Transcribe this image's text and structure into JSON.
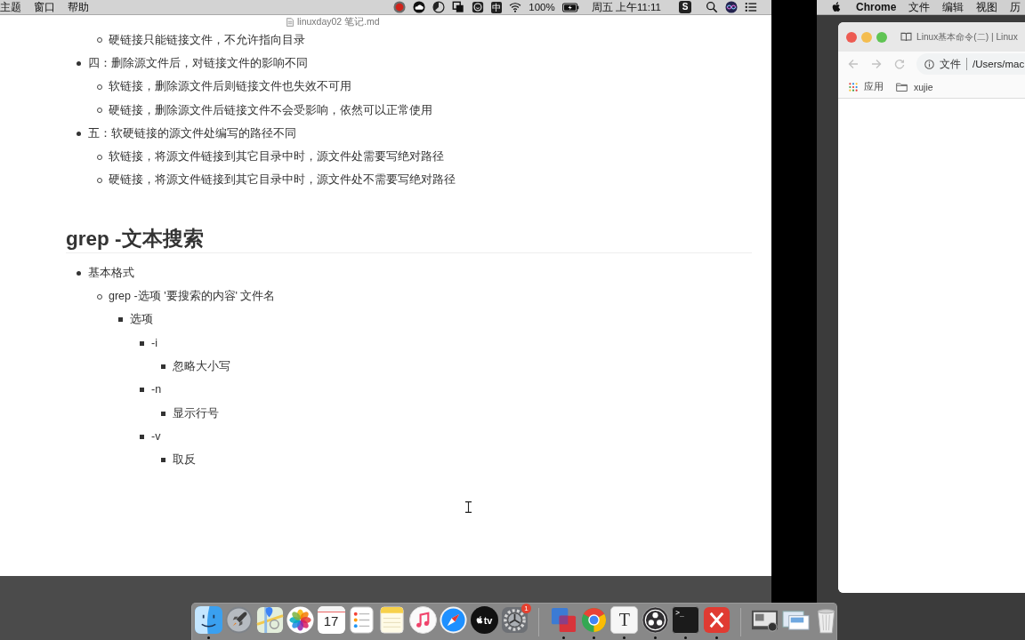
{
  "left_menu_bar": {
    "items": [
      "主题",
      "窗口",
      "帮助"
    ],
    "status_items": [
      {
        "kind": "record"
      },
      {
        "kind": "cloud"
      },
      {
        "kind": "half_circle"
      },
      {
        "kind": "squares"
      },
      {
        "kind": "smiley"
      },
      {
        "kind": "input_method",
        "label": "中"
      },
      {
        "kind": "wifi"
      },
      {
        "kind": "percent",
        "label": "100%"
      },
      {
        "kind": "battery"
      },
      {
        "kind": "clock",
        "label": "周五 上午11:11"
      },
      {
        "kind": "app",
        "label": "S"
      },
      {
        "kind": "search"
      },
      {
        "kind": "orb"
      },
      {
        "kind": "menu_list"
      }
    ]
  },
  "editor": {
    "title": "linuxday02 笔记.md",
    "sections": [
      {
        "items": [
          {
            "children": [
              {
                "text": "硬链接只能链接文件，不允许指向目录"
              }
            ]
          },
          {
            "text": "四：删除源文件后，对链接文件的影响不同",
            "children": [
              {
                "text": "软链接，删除源文件后则链接文件也失效不可用"
              },
              {
                "text": "硬链接，删除源文件后链接文件不会受影响，依然可以正常使用"
              }
            ]
          },
          {
            "text": "五：软硬链接的源文件处编写的路径不同",
            "children": [
              {
                "text": "软链接，将源文件链接到其它目录中时，源文件处需要写绝对路径"
              },
              {
                "text": "硬链接，将源文件链接到其它目录中时，源文件处不需要写绝对路径"
              }
            ]
          }
        ]
      },
      {
        "heading": "grep -文本搜索",
        "items": [
          {
            "text": "基本格式",
            "children": [
              {
                "text": "grep -选项 '要搜索的内容' 文件名",
                "children": [
                  {
                    "text": "选项",
                    "children": [
                      {
                        "text": "-i",
                        "children": [
                          {
                            "text": "忽略大小写"
                          }
                        ]
                      },
                      {
                        "text": "-n",
                        "children": [
                          {
                            "text": "显示行号"
                          }
                        ]
                      },
                      {
                        "text": "-v",
                        "children": [
                          {
                            "text": "取反"
                          }
                        ]
                      }
                    ]
                  }
                ]
              }
            ]
          }
        ]
      }
    ]
  },
  "dock": {
    "groups": [
      {
        "items": [
          {
            "kind": "finder",
            "running": true
          },
          {
            "kind": "launchpad",
            "running": false
          },
          {
            "kind": "maps",
            "running": false
          },
          {
            "kind": "photos",
            "running": false
          },
          {
            "kind": "calendar",
            "label": "17",
            "running": false
          },
          {
            "kind": "reminders",
            "running": false
          },
          {
            "kind": "notes",
            "running": false
          },
          {
            "kind": "music",
            "running": false
          },
          {
            "kind": "safari",
            "running": false
          },
          {
            "kind": "tv",
            "label": "tv",
            "running": false
          },
          {
            "kind": "settings",
            "badge": "1",
            "running": false
          }
        ]
      },
      {
        "items": [
          {
            "kind": "parallels",
            "running": true
          },
          {
            "kind": "chrome",
            "running": true
          },
          {
            "kind": "typora",
            "label": "T",
            "running": true
          },
          {
            "kind": "obs",
            "running": true
          },
          {
            "kind": "terminal",
            "label": ">_",
            "running": true
          },
          {
            "kind": "xmind",
            "running": true
          }
        ]
      },
      {
        "items": [
          {
            "kind": "screenshot",
            "running": false
          },
          {
            "kind": "preview",
            "running": false
          },
          {
            "kind": "trash",
            "running": false
          }
        ]
      }
    ]
  },
  "right_menu_bar": {
    "app_name": "Chrome",
    "items": [
      "文件",
      "编辑",
      "视图",
      "历"
    ]
  },
  "browser": {
    "tab_title": "Linux基本命令(二) | Linux",
    "address": {
      "chip": "文件",
      "text": "/Users/mac"
    },
    "bookmarks": [
      {
        "kind": "apps",
        "label": "应用"
      },
      {
        "kind": "folder",
        "label": "xujie"
      }
    ]
  }
}
